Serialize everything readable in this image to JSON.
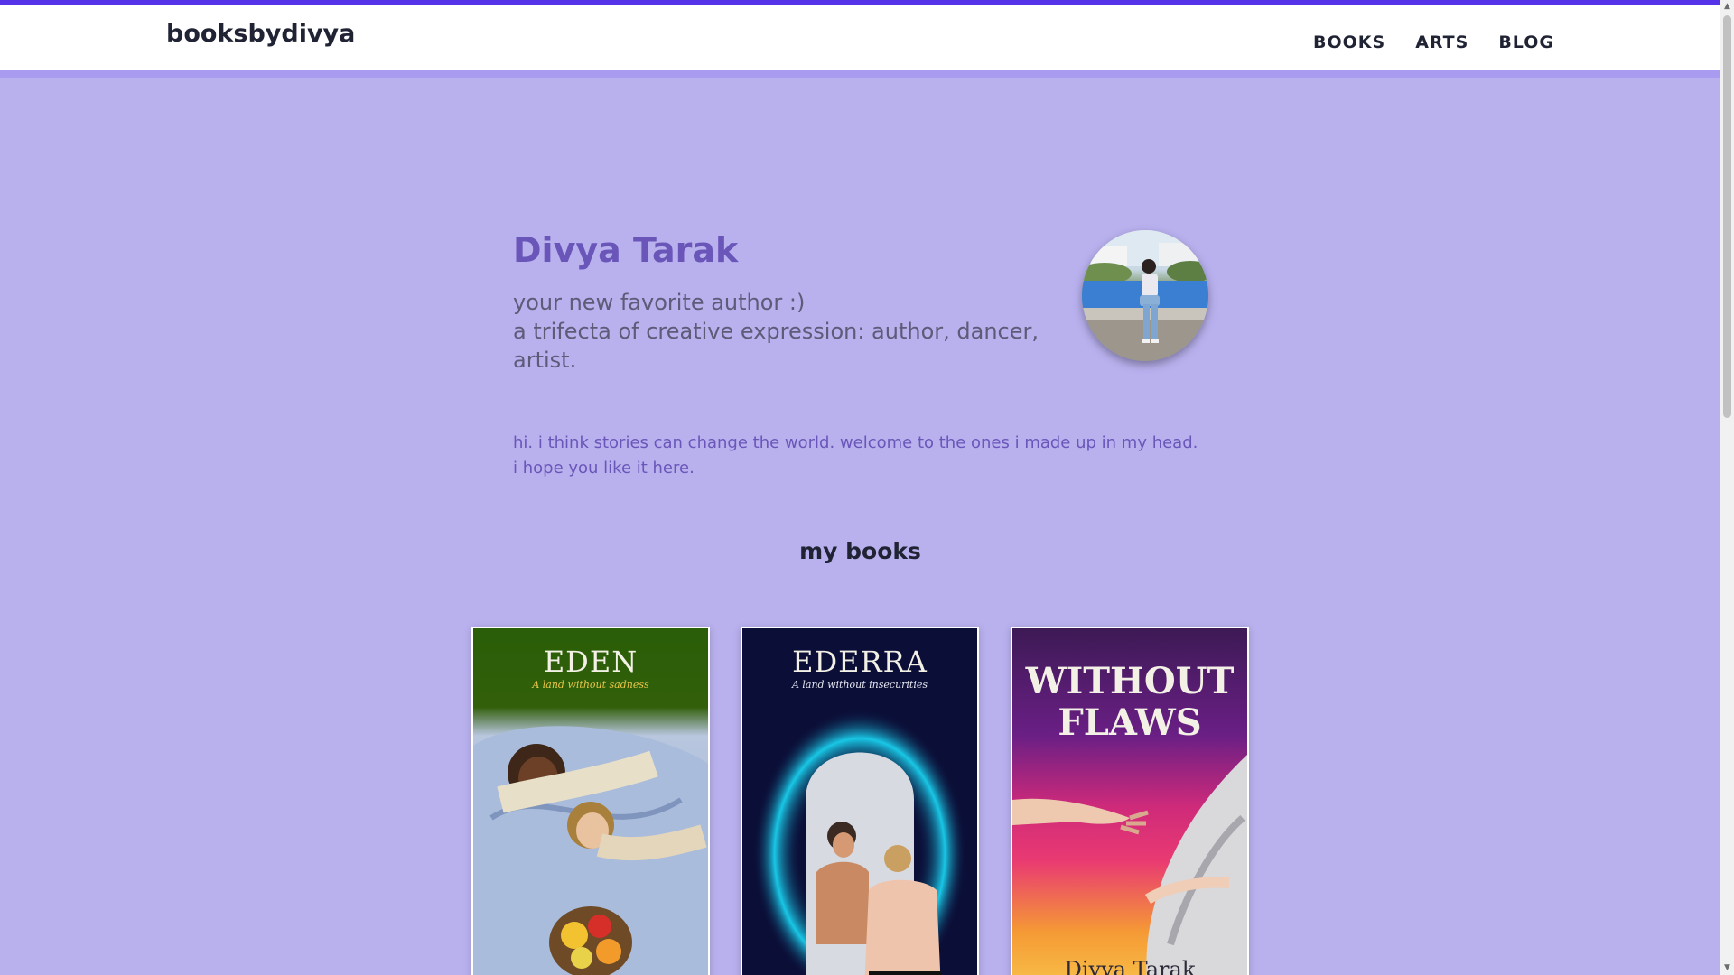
{
  "header": {
    "brand": "booksbydivya",
    "nav": [
      {
        "label": "BOOKS"
      },
      {
        "label": "ARTS"
      },
      {
        "label": "BLOG"
      }
    ]
  },
  "hero": {
    "name": "Divya Tarak",
    "tagline_line1": "your new favorite author :)",
    "tagline_line2": "a trifecta of creative expression: author, dancer, artist.",
    "avatar_alt": "photo of Divya Tarak sitting by a fountain"
  },
  "intro": {
    "line1": "hi. i think stories can change the world. welcome to the ones i made up in my head.",
    "line2": "i hope you like it here."
  },
  "books_section": {
    "title": "my books",
    "books": [
      {
        "title": "EDEN",
        "subtitle": "A land without sadness",
        "author": ""
      },
      {
        "title": "EDERRA",
        "subtitle": "A land without insecurities",
        "author": ""
      },
      {
        "title": "WITHOUT FLAWS",
        "subtitle": "",
        "author": "Divya Tarak"
      }
    ]
  },
  "colors": {
    "accent": "#5433e8",
    "background": "#b9b1ee",
    "heading": "#6a56b9"
  },
  "scrollbar": {
    "up_icon": "▲",
    "down_icon": "▼"
  }
}
